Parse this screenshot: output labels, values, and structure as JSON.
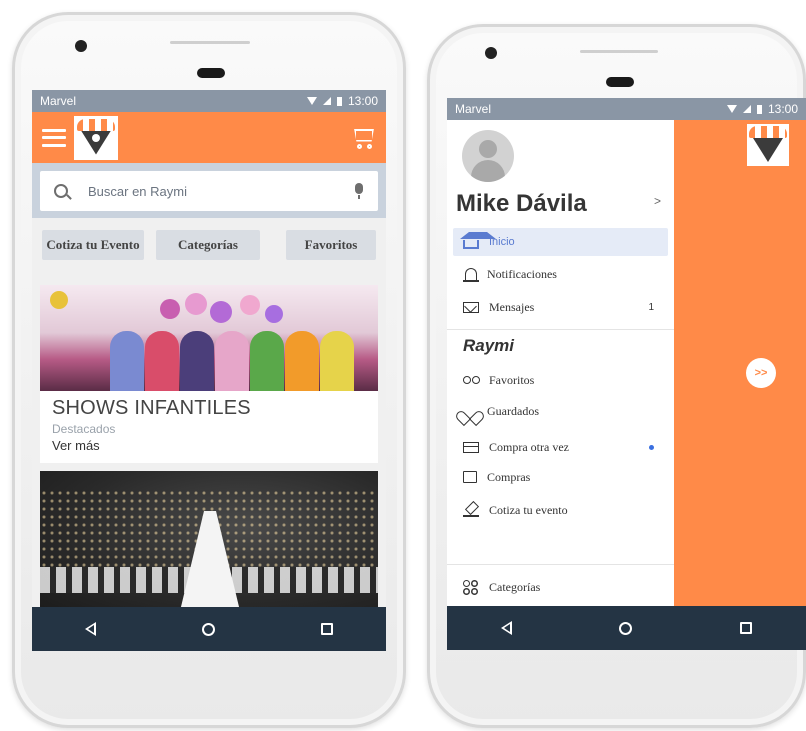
{
  "status_bar": {
    "carrier": "Marvel",
    "time": "13:00"
  },
  "home": {
    "search": {
      "placeholder": "Buscar en Raymi"
    },
    "chips": [
      "Cotiza tu Evento",
      "Categorías",
      "Favoritos"
    ],
    "cards": [
      {
        "title": "SHOWS INFANTILES",
        "subtitle": "Destacados",
        "link": "Ver más"
      }
    ]
  },
  "drawer": {
    "user_name": "Mike Dávila",
    "chevron": ">",
    "items_top": [
      {
        "label": "Inicio",
        "icon": "home-icon",
        "active": true
      },
      {
        "label": "Notificaciones",
        "icon": "bell-icon"
      },
      {
        "label": "Mensajes",
        "icon": "mail-icon",
        "badge": "1"
      }
    ],
    "section_title": "Raymi",
    "items_section": [
      {
        "label": "Favoritos",
        "icon": "glasses-icon"
      },
      {
        "label": "Guardados",
        "icon": "heart-icon"
      },
      {
        "label": "Compra otra vez",
        "icon": "card-icon",
        "dot": true
      },
      {
        "label": "Compras",
        "icon": "box-icon"
      },
      {
        "label": "Cotiza tu evento",
        "icon": "gavel-icon"
      }
    ],
    "items_bottom": [
      {
        "label": "Categorías",
        "icon": "grid-icon"
      }
    ],
    "more_button": ">>"
  },
  "colors": {
    "brand_orange": "#ff8a48",
    "status_bar": "#8a96a5",
    "nav_bar": "#243444",
    "active_blue": "#5a7bd0"
  }
}
